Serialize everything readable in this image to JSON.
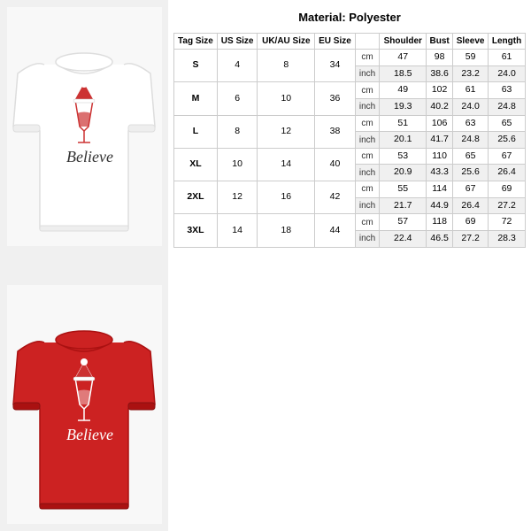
{
  "material": "Material: Polyester",
  "columns": {
    "tag_size": "Tag Size",
    "us_size": "US Size",
    "ukau_size": "UK/AU Size",
    "eu_size": "EU Size",
    "shoulder": "Shoulder",
    "bust": "Bust",
    "sleeve": "Sleeve",
    "length": "Length"
  },
  "sizes": [
    {
      "tag": "S",
      "us": "4",
      "ukau": "8",
      "eu": "34",
      "cm": {
        "shoulder": "47",
        "bust": "98",
        "sleeve": "59",
        "length": "61"
      },
      "inch": {
        "shoulder": "18.5",
        "bust": "38.6",
        "sleeve": "23.2",
        "length": "24.0"
      }
    },
    {
      "tag": "M",
      "us": "6",
      "ukau": "10",
      "eu": "36",
      "cm": {
        "shoulder": "49",
        "bust": "102",
        "sleeve": "61",
        "length": "63"
      },
      "inch": {
        "shoulder": "19.3",
        "bust": "40.2",
        "sleeve": "24.0",
        "length": "24.8"
      }
    },
    {
      "tag": "L",
      "us": "8",
      "ukau": "12",
      "eu": "38",
      "cm": {
        "shoulder": "51",
        "bust": "106",
        "sleeve": "63",
        "length": "65"
      },
      "inch": {
        "shoulder": "20.1",
        "bust": "41.7",
        "sleeve": "24.8",
        "length": "25.6"
      }
    },
    {
      "tag": "XL",
      "us": "10",
      "ukau": "14",
      "eu": "40",
      "cm": {
        "shoulder": "53",
        "bust": "110",
        "sleeve": "65",
        "length": "67"
      },
      "inch": {
        "shoulder": "20.9",
        "bust": "43.3",
        "sleeve": "25.6",
        "length": "26.4"
      }
    },
    {
      "tag": "2XL",
      "us": "12",
      "ukau": "16",
      "eu": "42",
      "cm": {
        "shoulder": "55",
        "bust": "114",
        "sleeve": "67",
        "length": "69"
      },
      "inch": {
        "shoulder": "21.7",
        "bust": "44.9",
        "sleeve": "26.4",
        "length": "27.2"
      }
    },
    {
      "tag": "3XL",
      "us": "14",
      "ukau": "18",
      "eu": "44",
      "cm": {
        "shoulder": "57",
        "bust": "118",
        "sleeve": "69",
        "length": "72"
      },
      "inch": {
        "shoulder": "22.4",
        "bust": "46.5",
        "sleeve": "27.2",
        "length": "28.3"
      }
    }
  ]
}
